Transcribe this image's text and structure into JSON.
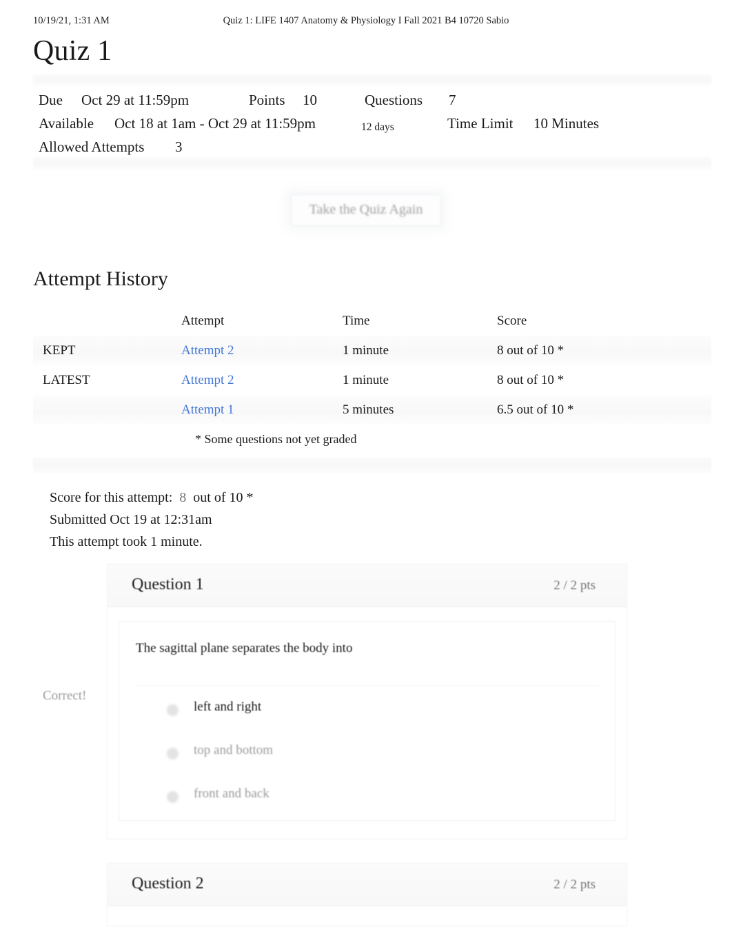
{
  "print_header": {
    "date": "10/19/21, 1:31 AM",
    "title": "Quiz 1: LIFE 1407 Anatomy & Physiology I Fall 2021 B4 10720 Sabio"
  },
  "page_title": "Quiz 1",
  "quiz_meta": {
    "due_label": "Due",
    "due_value": "Oct 29 at 11:59pm",
    "points_label": "Points",
    "points_value": "10",
    "questions_label": "Questions",
    "questions_value": "7",
    "available_label": "Available",
    "available_value": "Oct 18 at 1am - Oct 29 at 11:59pm",
    "available_duration": "12 days",
    "time_limit_label": "Time Limit",
    "time_limit_value": "10 Minutes",
    "allowed_attempts_label": "Allowed Attempts",
    "allowed_attempts_value": "3"
  },
  "retake_button": "Take the Quiz Again",
  "attempt_history": {
    "heading": "Attempt History",
    "columns": [
      "",
      "Attempt",
      "Time",
      "Score"
    ],
    "rows": [
      {
        "status": "KEPT",
        "attempt": "Attempt 2",
        "time": "1 minute",
        "score": "8 out of 10 *"
      },
      {
        "status": "LATEST",
        "attempt": "Attempt 2",
        "time": "1 minute",
        "score": "8 out of 10 *"
      },
      {
        "status": "",
        "attempt": "Attempt 1",
        "time": "5 minutes",
        "score": "6.5 out of 10 *"
      }
    ],
    "footnote": "* Some questions not yet graded"
  },
  "attempt_summary": {
    "score_label": "Score for this attempt:",
    "score_value": "8",
    "score_suffix": "out of 10 *",
    "submitted": "Submitted Oct 19 at 12:31am",
    "duration": "This attempt took 1 minute."
  },
  "questions": [
    {
      "title": "Question 1",
      "points": "2 / 2 pts",
      "text": "The sagittal plane separates the body into",
      "feedback": "Correct!",
      "answers": [
        {
          "label": "left and right",
          "selected": true
        },
        {
          "label": "top and bottom",
          "selected": false
        },
        {
          "label": "front and back",
          "selected": false
        }
      ]
    },
    {
      "title": "Question 2",
      "points": "2 / 2 pts",
      "text": "",
      "feedback": "",
      "answers": []
    }
  ],
  "colors": {
    "link": "#4278d6",
    "muted": "#9b9b9b",
    "text": "#1a1a1a",
    "points": "#757575"
  }
}
